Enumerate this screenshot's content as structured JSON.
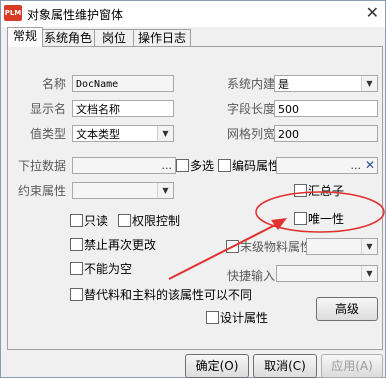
{
  "window": {
    "icon_text": "PLM",
    "title": "对象属性维护窗体",
    "close_glyph": "✕"
  },
  "tabs": [
    {
      "label": "常规"
    },
    {
      "label": "系统角色"
    },
    {
      "label": "岗位"
    },
    {
      "label": "操作日志"
    }
  ],
  "form": {
    "name": {
      "label": "名称",
      "value": "DocName"
    },
    "display_name": {
      "label": "显示名",
      "value": "文档名称"
    },
    "value_type": {
      "label": "值类型",
      "value": "文本类型"
    },
    "dropdown_data": {
      "label": "下拉数据",
      "value": "",
      "dots": "..."
    },
    "constraint": {
      "label": "约束属性",
      "value": ""
    },
    "system_builtin": {
      "label": "系统内建",
      "value": "是"
    },
    "field_length": {
      "label": "字段长度",
      "value": "500"
    },
    "grid_col_width": {
      "label": "网格列宽",
      "value": "200"
    },
    "encode_attr": {
      "value": "",
      "dots": "...",
      "clear": "✕"
    },
    "quick_input": {
      "label": "快捷输入",
      "value": ""
    },
    "alternate_attr": {
      "value": ""
    }
  },
  "checkboxes": {
    "multiselect": "多选",
    "encode_property": "编码属性",
    "summary": "汇总子",
    "readonly": "只读",
    "permission": "权限控制",
    "unique": "唯一性",
    "no_change": "禁止再次更改",
    "alt_material": "末级物料属性",
    "not_empty": "不能为空",
    "alt_same_attr": "替代料和主料的该属性可以不同",
    "design_attr": "设计属性"
  },
  "buttons": {
    "advanced": "高级",
    "ok": "确定(O)",
    "cancel": "取消(C)",
    "apply": "应用(A)"
  },
  "colors": {
    "annotation_red": "#e03030",
    "icon_red": "#d83a23"
  }
}
